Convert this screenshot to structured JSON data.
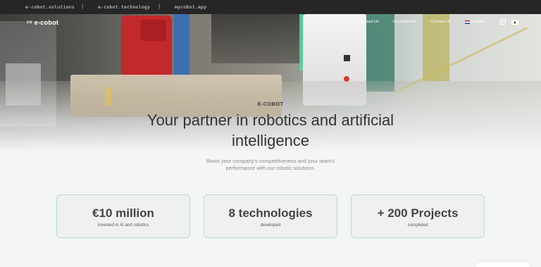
{
  "topbar": {
    "domains": [
      "e-cobot.solutions",
      "e-cobot.technology",
      "mycobot.app"
    ],
    "separator": "|"
  },
  "header": {
    "logo_text": "e-cobot",
    "nav": [
      "About Us",
      "Recruitments",
      "Contact Us"
    ],
    "language": "English",
    "social": [
      "linkedin-icon",
      "youtube-icon"
    ]
  },
  "hero": {
    "eyebrow": "E-COBOT",
    "headline_line1": "Your partner in robotics and artificial",
    "headline_line2": "intelligence",
    "subtitle_line1": "Boost your company's competitiveness and your team's",
    "subtitle_line2": "performance with our robotic solutions."
  },
  "stats": [
    {
      "value": "€10 million",
      "label": "invested in AI and robotics"
    },
    {
      "value": "8 technologies",
      "label": "developed"
    },
    {
      "value": "+ 200 Projects",
      "label": "completed"
    }
  ],
  "colors": {
    "topbar_bg": "#262626",
    "card_border": "#b9dcd3",
    "text_dark": "#333333"
  }
}
